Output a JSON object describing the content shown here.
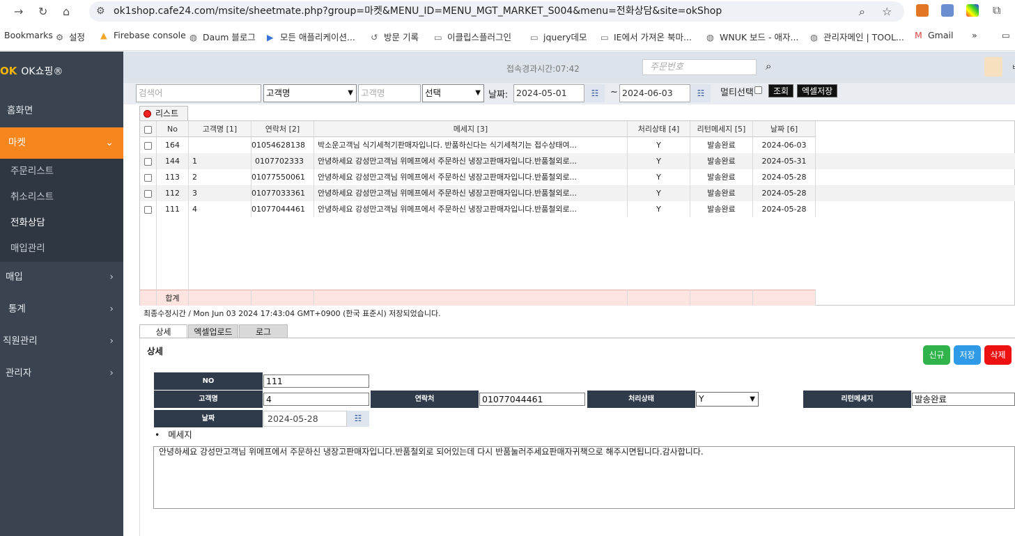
{
  "browser": {
    "url": "ok1shop.cafe24.com/msite/sheetmate.php?group=마켓&MENU_ID=MENU_MGT_MARKET_S004&menu=전화상담&site=okShop",
    "bookmarks": [
      "Bookmarks",
      "설정",
      "Firebase console",
      "Daum 블로그",
      "모든 애플리케이션...",
      "방문 기록",
      "이클립스플러그인",
      "jquery데모",
      "IE에서 가져온 북마...",
      "WNUK 보드 - 애자...",
      "관리자메인 | TOOL...",
      "Gmail",
      "»"
    ]
  },
  "sidebar": {
    "logo_mark": "OK",
    "logo_text": "OK쇼핑®",
    "items": [
      {
        "label": "홈화면"
      },
      {
        "label": "마켓"
      },
      {
        "label": "매입"
      },
      {
        "label": "통계"
      },
      {
        "label": "직원관리"
      },
      {
        "label": "관리자"
      }
    ],
    "sub_items": [
      {
        "label": "주문리스트"
      },
      {
        "label": "취소리스트"
      },
      {
        "label": "전화상담"
      },
      {
        "label": "매입관리"
      }
    ]
  },
  "header": {
    "elapsed": "접속경과시간:07:42",
    "order_placeholder": "주문번호"
  },
  "filter": {
    "search_placeholder": "검색어",
    "field_select": "고객명",
    "name_placeholder": "고객명",
    "select2": "선택",
    "date_label": "날짜:",
    "date_from": "2024-05-01",
    "tilde": "~",
    "date_to": "2024-06-03",
    "multi_label": "멀티선택",
    "query_btn": "조회",
    "excel_btn": "엑셀저장"
  },
  "grid": {
    "tab_label": "리스트",
    "columns": [
      "No",
      "고객명 [1]",
      "연락처 [2]",
      "메세지 [3]",
      "처리상태 [4]",
      "리턴메세지 [5]",
      "날짜 [6]"
    ],
    "rows": [
      {
        "no": "164",
        "name": "",
        "tel": "01054628138",
        "msg": "박소운고객님 식기세척기판매자입니다. 반품하신다는 식기세척기는 접수상태여...",
        "status": "Y",
        "ret": "발송완료",
        "date": "2024-06-03"
      },
      {
        "no": "144",
        "name": "1",
        "tel": "0107702333",
        "msg": "안녕하세요 강성만고객님 위메프에서 주문하신 냉장고판매자입니다.반품철외로...",
        "status": "Y",
        "ret": "발송완료",
        "date": "2024-05-31"
      },
      {
        "no": "113",
        "name": "2",
        "tel": "01077550061",
        "msg": "안녕하세요 강성만고객님 위메프에서 주문하신 냉장고판매자입니다.반품철외로...",
        "status": "Y",
        "ret": "발송완료",
        "date": "2024-05-28"
      },
      {
        "no": "112",
        "name": "3",
        "tel": "01077033361",
        "msg": "안녕하세요 강성만고객님 위메프에서 주문하신 냉장고판매자입니다.반품철외로...",
        "status": "Y",
        "ret": "발송완료",
        "date": "2024-05-28"
      },
      {
        "no": "111",
        "name": "4",
        "tel": "01077044461",
        "msg": "안녕하세요 강성만고객님 위메프에서 주문하신 냉장고판매자입니다.반품철외로...",
        "status": "Y",
        "ret": "발송완료",
        "date": "2024-05-28"
      }
    ],
    "sum_label": "합계",
    "status_text": "최종수정시간 / Mon Jun 03 2024 17:43:04 GMT+0900 (한국 표준시) 저장되었습니다."
  },
  "detail": {
    "tabs": [
      "상세",
      "엑셀업로드",
      "로그"
    ],
    "title": "상세",
    "buttons": {
      "new": "신규",
      "save": "저장",
      "delete": "삭제"
    },
    "labels": {
      "no": "NO",
      "name": "고객명",
      "tel": "연락처",
      "status": "처리상태",
      "ret": "리턴메세지",
      "date": "날짜"
    },
    "values": {
      "no": "111",
      "name": "4",
      "tel": "01077044461",
      "status": "Y",
      "ret": "발송완료",
      "date": "2024-05-28"
    },
    "msg_label": "메세지",
    "message": "안녕하세요 강성만고객님 위메프에서 주문하신 냉장고판매자입니다.반품철외로 되어있는데 다시 반품눌러주세요판매자귀책으로 해주시면됩니다.감사합니다."
  },
  "colors": {
    "sidebar": "#3a4350",
    "accent": "#f7861e",
    "new": "#2fb34a",
    "save": "#2f9be8",
    "delete": "#ee1111"
  }
}
